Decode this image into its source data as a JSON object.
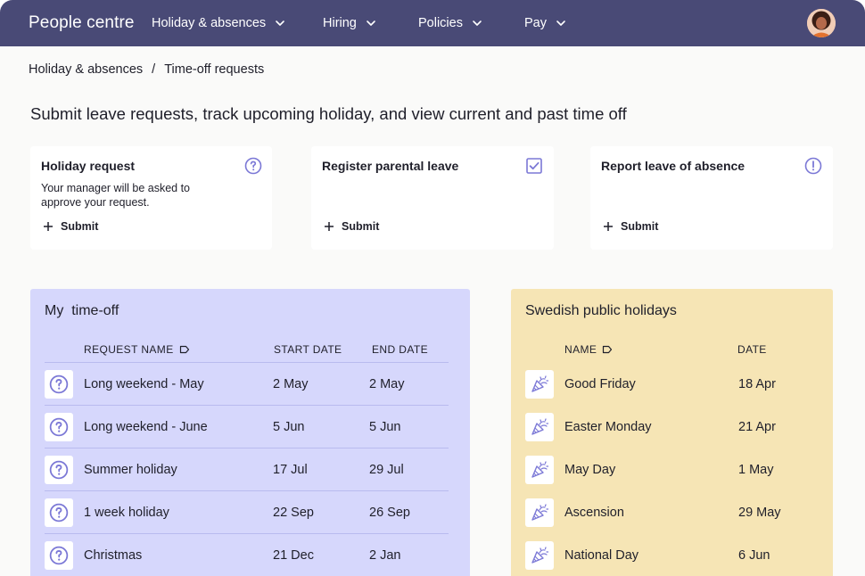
{
  "header": {
    "brand": "People centre",
    "nav": [
      {
        "label": "Holiday & absences"
      },
      {
        "label": "Hiring"
      },
      {
        "label": "Policies"
      },
      {
        "label": "Pay"
      }
    ]
  },
  "breadcrumb": {
    "items": [
      "Holiday & absences",
      "Time-off requests"
    ],
    "separator": "/"
  },
  "page_title": "Submit leave requests, track upcoming holiday, and view current and past time off",
  "cards": [
    {
      "title": "Holiday request",
      "description": "Your manager will be asked to approve your request.",
      "icon": "question-circle-icon",
      "action": "Submit"
    },
    {
      "title": "Register parental leave",
      "description": "",
      "icon": "checkbox-icon",
      "action": "Submit"
    },
    {
      "title": "Report leave of absence",
      "description": "",
      "icon": "exclamation-circle-icon",
      "action": "Submit"
    }
  ],
  "my_time_off": {
    "title": "My  time-off",
    "columns": [
      "REQUEST NAME",
      "START DATE",
      "END DATE"
    ],
    "rows": [
      {
        "name": "Long weekend - May",
        "start": "2 May",
        "end": "2 May"
      },
      {
        "name": "Long weekend - June",
        "start": "5 Jun",
        "end": "5 Jun"
      },
      {
        "name": "Summer holiday",
        "start": "17 Jul",
        "end": "29 Jul"
      },
      {
        "name": "1 week holiday",
        "start": "22 Sep",
        "end": "26 Sep"
      },
      {
        "name": "Christmas",
        "start": "21 Dec",
        "end": "2 Jan"
      }
    ]
  },
  "public_holidays": {
    "title": "Swedish public holidays",
    "columns": [
      "NAME",
      "DATE"
    ],
    "rows": [
      {
        "name": "Good Friday",
        "date": "18 Apr"
      },
      {
        "name": "Easter Monday",
        "date": "21 Apr"
      },
      {
        "name": "May Day",
        "date": "1 May"
      },
      {
        "name": "Ascension",
        "date": "29 May"
      },
      {
        "name": "National Day",
        "date": "6 Jun"
      }
    ]
  },
  "colors": {
    "topbar": "#494a76",
    "accent": "#7b78d6",
    "time_off_panel": "#d6d7fc",
    "holidays_panel": "#f6e5b5"
  }
}
